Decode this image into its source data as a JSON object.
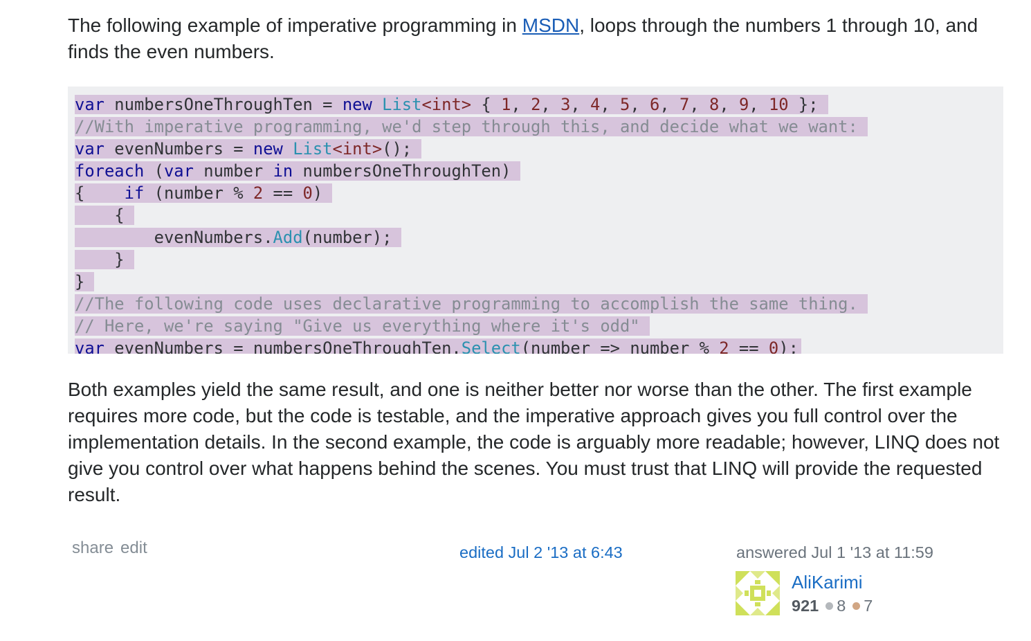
{
  "intro": {
    "before_link": "The following example of imperative programming in ",
    "link_text": "MSDN",
    "after_link": ", loops through the numbers 1 through 10, and finds the even numbers."
  },
  "code": {
    "l1": {
      "a": "var",
      "b": " numbersOneThroughTen = ",
      "c": "new",
      "d": " ",
      "e": "List",
      "f": "<int>",
      "g": " { ",
      "n1": "1",
      "s1": ", ",
      "n2": "2",
      "s2": ", ",
      "n3": "3",
      "s3": ", ",
      "n4": "4",
      "s4": ", ",
      "n5": "5",
      "s5": ", ",
      "n6": "6",
      "s6": ", ",
      "n7": "7",
      "s7": ", ",
      "n8": "8",
      "s8": ", ",
      "n9": "9",
      "s9": ", ",
      "n10": "10",
      "h": " };"
    },
    "l2": {
      "a": "//With imperative programming, we'd step through this, and decide what we want:"
    },
    "l3": {
      "a": "var",
      "b": " evenNumbers = ",
      "c": "new",
      "d": " ",
      "e": "List",
      "f": "<int>",
      "g": "();"
    },
    "l4": {
      "a": "foreach",
      "b": " (",
      "c": "var",
      "d": " number ",
      "e": "in",
      "f": " numbersOneThroughTen)"
    },
    "l5": {
      "a": "{    ",
      "b": "if",
      "c": " (number % ",
      "d": "2",
      "e": " == ",
      "f": "0",
      "g": ")"
    },
    "l6": {
      "a": "    {"
    },
    "l7": {
      "a": "        evenNumbers.",
      "b": "Add",
      "c": "(number);"
    },
    "l8": {
      "a": "    }"
    },
    "l9": {
      "a": "}"
    },
    "l10": {
      "a": "//The following code uses declarative programming to accomplish the same thing."
    },
    "l11": {
      "a": "// Here, we're saying \"Give us everything where it's odd\""
    },
    "l12": {
      "a": "var",
      "b": " evenNumbers = numbersOneThroughTen.",
      "c": "Select",
      "d": "(number => number % ",
      "e": "2",
      "f": " == ",
      "g": "0",
      "h": ");"
    }
  },
  "conclusion": "Both examples yield the same result, and one is neither better nor worse than the other. The first example requires more code, but the code is testable, and the imperative approach gives you full control over the implementation details. In the second example, the code is arguably more readable; however, LINQ does not give you control over what happens behind the scenes. You must trust that LINQ will provide the requested result.",
  "footer": {
    "share_label": "share",
    "edit_label": "edit",
    "edited_text": "edited Jul 2 '13 at 6:43",
    "answered_text": "answered Jul 1 '13 at 11:59",
    "username": "AliKarimi",
    "reputation": "921",
    "silver_count": "8",
    "bronze_count": "7"
  },
  "colors": {
    "link": "#1a5db6",
    "highlight": "#d7c4dc",
    "code_bg": "#eeeff1",
    "silver": "#b4b8bc",
    "bronze": "#d1a684"
  }
}
